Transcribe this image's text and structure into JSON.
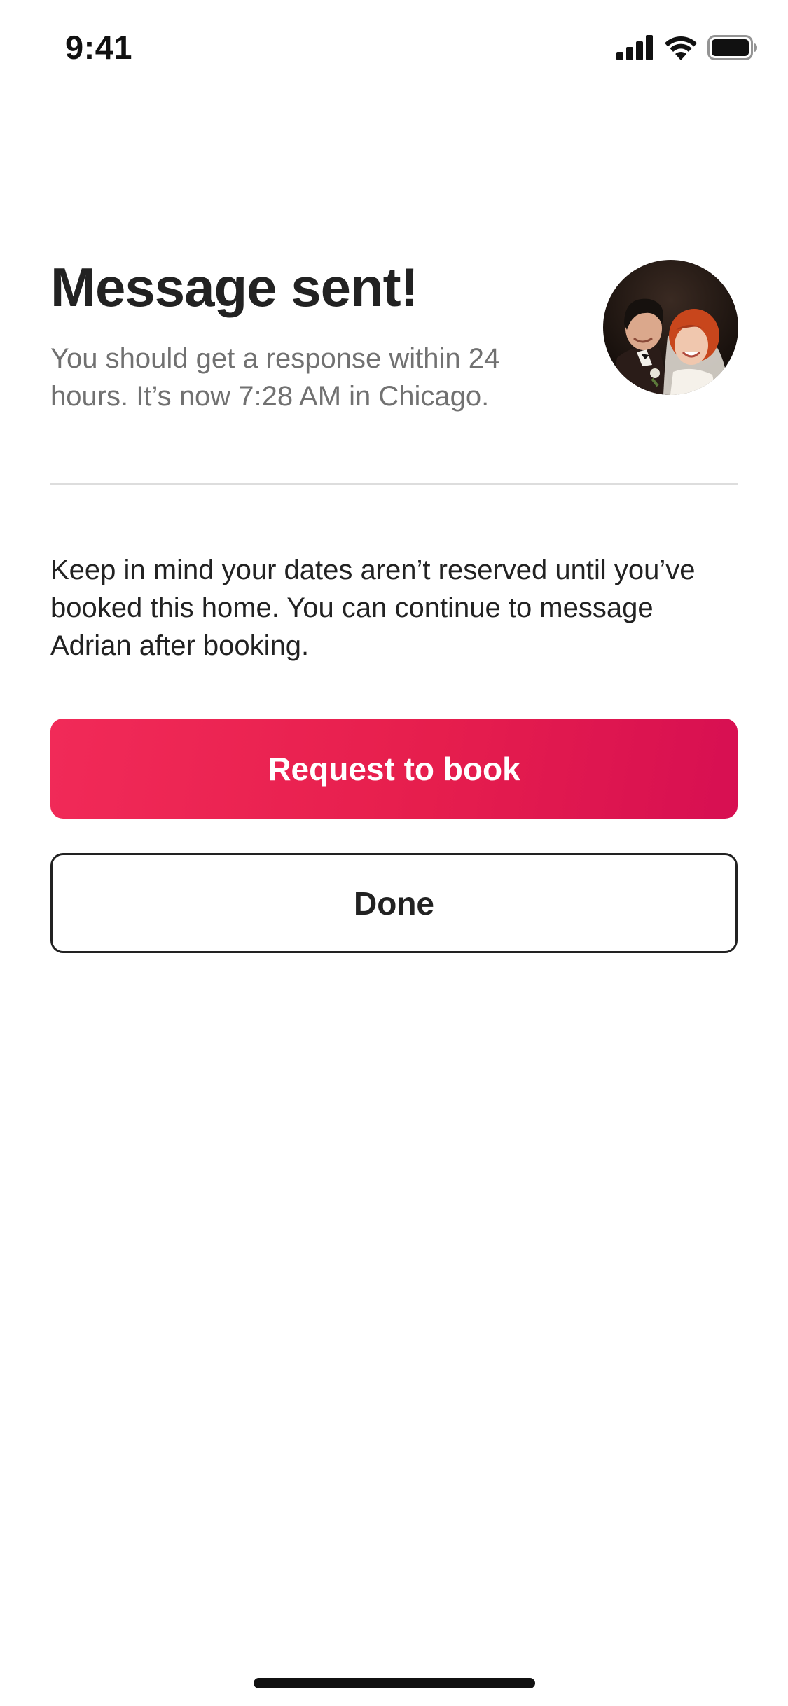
{
  "status_bar": {
    "time": "9:41",
    "icons": [
      "cellular-signal-icon",
      "wifi-icon",
      "battery-icon"
    ]
  },
  "header": {
    "title": "Message sent!",
    "subtitle": "You should get a response within 24 hours. It’s now 7:28 AM in Chicago."
  },
  "host_avatar": {
    "icon": "host-avatar-photo"
  },
  "notice": {
    "text": "Keep in mind your dates aren’t reserved until you’ve booked this home. You can continue to message Adrian after booking."
  },
  "actions": {
    "primary_label": "Request to book",
    "secondary_label": "Done"
  },
  "colors": {
    "brand": "#E61E4D",
    "text_primary": "#222222",
    "text_secondary": "#717171",
    "divider": "#DDDDDD"
  }
}
